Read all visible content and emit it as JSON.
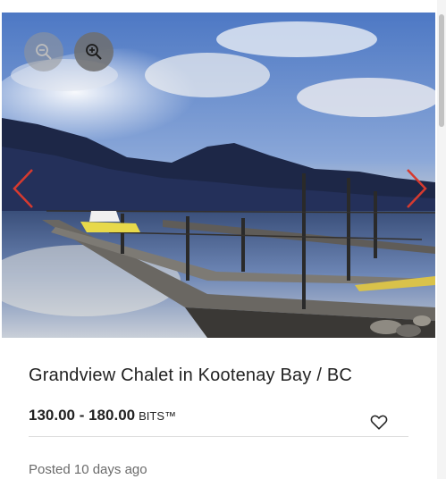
{
  "listing": {
    "title": "Grandview Chalet in Kootenay Bay / BC",
    "price_range": "130.00 - 180.00",
    "currency": "BITS™",
    "posted": "Posted 10 days ago",
    "favorited": false
  },
  "gallery": {
    "image_subject": "mountain lake with boat dock",
    "controls": {
      "zoom_out_icon": "zoom-out-icon",
      "zoom_in_icon": "zoom-in-icon",
      "prev_icon": "chevron-left-icon",
      "next_icon": "chevron-right-icon"
    }
  },
  "colors": {
    "arrow": "#d63a2f",
    "title_text": "#222222",
    "meta_text": "#6b6b6b"
  }
}
